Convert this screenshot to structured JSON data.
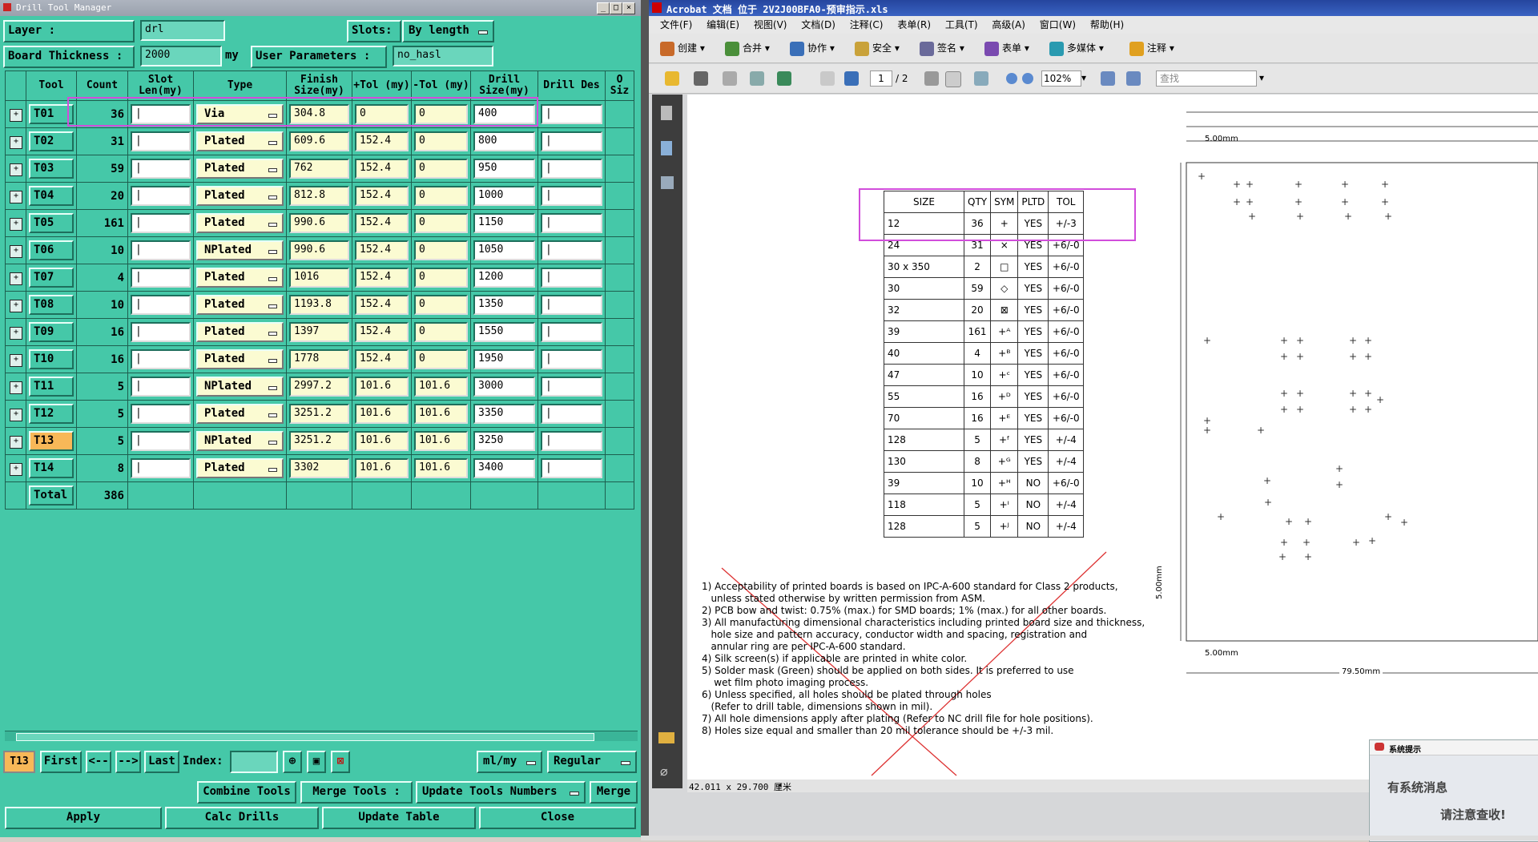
{
  "dtm": {
    "window_title": "Drill Tool Manager",
    "layer_label": "Layer                :",
    "layer_value": "drl",
    "slots_label": "Slots:",
    "slots_value": "By length",
    "board_thickness_label": "Board Thickness  :",
    "board_thickness_value": "2000",
    "board_thickness_unit": "my",
    "user_params_label": "User Parameters  :",
    "user_params_value": "no_hasl",
    "columns": [
      "Tool",
      "Count",
      "Slot Len(my)",
      "Type",
      "Finish Size(my)",
      "+Tol (my)",
      "-Tol (my)",
      "Drill Size(my)",
      "Drill Des",
      "O Siz"
    ],
    "rows": [
      {
        "tool": "T01",
        "count": "36",
        "type": "Via",
        "finish": "304.8",
        "ptol": "0",
        "ntol": "0",
        "drill": "400"
      },
      {
        "tool": "T02",
        "count": "31",
        "type": "Plated",
        "finish": "609.6",
        "ptol": "152.4",
        "ntol": "0",
        "drill": "800"
      },
      {
        "tool": "T03",
        "count": "59",
        "type": "Plated",
        "finish": "762",
        "ptol": "152.4",
        "ntol": "0",
        "drill": "950"
      },
      {
        "tool": "T04",
        "count": "20",
        "type": "Plated",
        "finish": "812.8",
        "ptol": "152.4",
        "ntol": "0",
        "drill": "1000"
      },
      {
        "tool": "T05",
        "count": "161",
        "type": "Plated",
        "finish": "990.6",
        "ptol": "152.4",
        "ntol": "0",
        "drill": "1150"
      },
      {
        "tool": "T06",
        "count": "10",
        "type": "NPlated",
        "finish": "990.6",
        "ptol": "152.4",
        "ntol": "0",
        "drill": "1050"
      },
      {
        "tool": "T07",
        "count": "4",
        "type": "Plated",
        "finish": "1016",
        "ptol": "152.4",
        "ntol": "0",
        "drill": "1200"
      },
      {
        "tool": "T08",
        "count": "10",
        "type": "Plated",
        "finish": "1193.8",
        "ptol": "152.4",
        "ntol": "0",
        "drill": "1350"
      },
      {
        "tool": "T09",
        "count": "16",
        "type": "Plated",
        "finish": "1397",
        "ptol": "152.4",
        "ntol": "0",
        "drill": "1550"
      },
      {
        "tool": "T10",
        "count": "16",
        "type": "Plated",
        "finish": "1778",
        "ptol": "152.4",
        "ntol": "0",
        "drill": "1950"
      },
      {
        "tool": "T11",
        "count": "5",
        "type": "NPlated",
        "finish": "2997.2",
        "ptol": "101.6",
        "ntol": "101.6",
        "drill": "3000"
      },
      {
        "tool": "T12",
        "count": "5",
        "type": "Plated",
        "finish": "3251.2",
        "ptol": "101.6",
        "ntol": "101.6",
        "drill": "3350"
      },
      {
        "tool": "T13",
        "count": "5",
        "type": "NPlated",
        "finish": "3251.2",
        "ptol": "101.6",
        "ntol": "101.6",
        "drill": "3250"
      },
      {
        "tool": "T14",
        "count": "8",
        "type": "Plated",
        "finish": "3302",
        "ptol": "101.6",
        "ntol": "101.6",
        "drill": "3400"
      }
    ],
    "total_label": "Total",
    "total_value": "386",
    "nav": {
      "current": "T13",
      "first": "First",
      "prev": "<--",
      "next": "-->",
      "last": "Last",
      "index_label": "Index:",
      "units": "ml/my",
      "mode": "Regular"
    },
    "actions": {
      "combine": "Combine Tools",
      "merge_label": "Merge Tools :",
      "update_numbers": "Update Tools Numbers",
      "merge": "Merge"
    },
    "footer": {
      "apply": "Apply",
      "calc": "Calc Drills",
      "update": "Update Table",
      "close": "Close"
    }
  },
  "acrobat": {
    "title": "Acrobat 文档 位于 2V2J00BFA0-预审指示.xls",
    "menu": [
      "文件(F)",
      "编辑(E)",
      "视图(V)",
      "文档(D)",
      "注释(C)",
      "表单(R)",
      "工具(T)",
      "高级(A)",
      "窗口(W)",
      "帮助(H)"
    ],
    "toolbar": [
      "创建",
      "合并",
      "协作",
      "安全",
      "签名",
      "表单",
      "多媒体",
      "注释"
    ],
    "page_current": "1",
    "page_total": "/ 2",
    "zoom": "102%",
    "search_placeholder": "查找",
    "legend_headers": [
      "SIZE",
      "QTY",
      "SYM",
      "PLTD",
      "TOL"
    ],
    "legend_rows": [
      {
        "size": "12",
        "qty": "36",
        "sym": "+",
        "pltd": "YES",
        "tol": "+/-3"
      },
      {
        "size": "24",
        "qty": "31",
        "sym": "×",
        "pltd": "YES",
        "tol": "+6/-0"
      },
      {
        "size": "30 x 350",
        "qty": "2",
        "sym": "□",
        "pltd": "YES",
        "tol": "+6/-0"
      },
      {
        "size": "30",
        "qty": "59",
        "sym": "◇",
        "pltd": "YES",
        "tol": "+6/-0"
      },
      {
        "size": "32",
        "qty": "20",
        "sym": "⊠",
        "pltd": "YES",
        "tol": "+6/-0"
      },
      {
        "size": "39",
        "qty": "161",
        "sym": "+ᴬ",
        "pltd": "YES",
        "tol": "+6/-0"
      },
      {
        "size": "40",
        "qty": "4",
        "sym": "+ᴮ",
        "pltd": "YES",
        "tol": "+6/-0"
      },
      {
        "size": "47",
        "qty": "10",
        "sym": "+ᶜ",
        "pltd": "YES",
        "tol": "+6/-0"
      },
      {
        "size": "55",
        "qty": "16",
        "sym": "+ᴰ",
        "pltd": "YES",
        "tol": "+6/-0"
      },
      {
        "size": "70",
        "qty": "16",
        "sym": "+ᴱ",
        "pltd": "YES",
        "tol": "+6/-0"
      },
      {
        "size": "128",
        "qty": "5",
        "sym": "+ᶠ",
        "pltd": "YES",
        "tol": "+/-4"
      },
      {
        "size": "130",
        "qty": "8",
        "sym": "+ᴳ",
        "pltd": "YES",
        "tol": "+/-4"
      },
      {
        "size": "39",
        "qty": "10",
        "sym": "+ᴴ",
        "pltd": "NO",
        "tol": "+6/-0"
      },
      {
        "size": "118",
        "qty": "5",
        "sym": "+ᴵ",
        "pltd": "NO",
        "tol": "+/-4"
      },
      {
        "size": "128",
        "qty": "5",
        "sym": "+ᴶ",
        "pltd": "NO",
        "tol": "+/-4"
      }
    ],
    "notes": [
      "1) Acceptability of printed boards is based on IPC-A-600 standard for Class 2 products,",
      "   unless stated otherwise by written permission from ASM.",
      "2) PCB bow and twist: 0.75% (max.) for SMD boards; 1% (max.) for all other boards.",
      "3) All manufacturing dimensional characteristics including printed board size and thickness,",
      "   hole size and pattern accuracy, conductor width and spacing, registration and",
      "   annular ring are per IPC-A-600 standard.",
      "4) Silk screen(s) if applicable are printed in white color.",
      "5) Solder mask (Green) should be applied on both sides. It is preferred to use",
      "    wet film photo imaging process.",
      "6) Unless specified, all holes should be plated through holes",
      "   (Refer to drill table, dimensions shown in mil).",
      "7) All hole dimensions apply after plating (Refer to NC drill file for hole positions).",
      "8) Holes size equal and smaller than 20 mil tolerance should be +/-3 mil."
    ],
    "dim_top": "5.00mm",
    "dim_bottom": "5.00mm",
    "dim_side": "5.00mm",
    "dim_width": "79.50mm",
    "page_size": "42.011 x 29.700 厘米",
    "popup_title": "系统提示",
    "popup_line1": "有系统消息",
    "popup_line2": "请注意查收!"
  }
}
